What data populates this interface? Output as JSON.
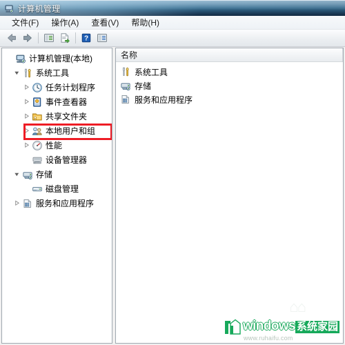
{
  "window": {
    "title": "计算机管理",
    "title_icon": "computer-management-icon"
  },
  "menubar": {
    "items": [
      {
        "label": "文件(F)",
        "name": "menu-file"
      },
      {
        "label": "操作(A)",
        "name": "menu-action"
      },
      {
        "label": "查看(V)",
        "name": "menu-view"
      },
      {
        "label": "帮助(H)",
        "name": "menu-help"
      }
    ]
  },
  "toolbar": {
    "buttons": [
      {
        "name": "back-arrow-icon",
        "tooltip": "后退"
      },
      {
        "name": "forward-arrow-icon",
        "tooltip": "前进"
      },
      {
        "name": "show-tree-icon",
        "tooltip": "显示/隐藏控制台树"
      },
      {
        "name": "export-list-icon",
        "tooltip": "导出列表"
      },
      {
        "name": "help-icon",
        "tooltip": "帮助"
      },
      {
        "name": "show-action-pane-icon",
        "tooltip": "显示/隐藏操作窗格"
      }
    ]
  },
  "tree": {
    "root": {
      "label": "计算机管理(本地)",
      "icon": "computer-icon"
    },
    "nodes": [
      {
        "label": "系统工具",
        "icon": "system-tools-icon",
        "expanded": true,
        "indent": 1
      },
      {
        "label": "任务计划程序",
        "icon": "clock-icon",
        "expanded": false,
        "indent": 2
      },
      {
        "label": "事件查看器",
        "icon": "event-viewer-icon",
        "expanded": false,
        "indent": 2
      },
      {
        "label": "共享文件夹",
        "icon": "shared-folders-icon",
        "expanded": false,
        "indent": 2
      },
      {
        "label": "本地用户和组",
        "icon": "users-groups-icon",
        "expanded": false,
        "indent": 2
      },
      {
        "label": "性能",
        "icon": "performance-icon",
        "expanded": false,
        "indent": 2
      },
      {
        "label": "设备管理器",
        "icon": "device-manager-icon",
        "expanded": null,
        "indent": 2,
        "highlighted": true
      },
      {
        "label": "存储",
        "icon": "storage-icon",
        "expanded": true,
        "indent": 1
      },
      {
        "label": "磁盘管理",
        "icon": "disk-management-icon",
        "expanded": null,
        "indent": 2
      },
      {
        "label": "服务和应用程序",
        "icon": "services-apps-icon",
        "expanded": false,
        "indent": 1
      }
    ],
    "highlight_color": "#ee1c25"
  },
  "list": {
    "columns": [
      "名称"
    ],
    "rows": [
      {
        "label": "系统工具",
        "icon": "system-tools-icon"
      },
      {
        "label": "存储",
        "icon": "storage-icon"
      },
      {
        "label": "服务和应用程序",
        "icon": "services-apps-icon"
      }
    ]
  },
  "watermark": {
    "en": "windows",
    "cn": "系统家园",
    "url": "www.ruhaifu.com",
    "brand_color": "#17a95b"
  }
}
